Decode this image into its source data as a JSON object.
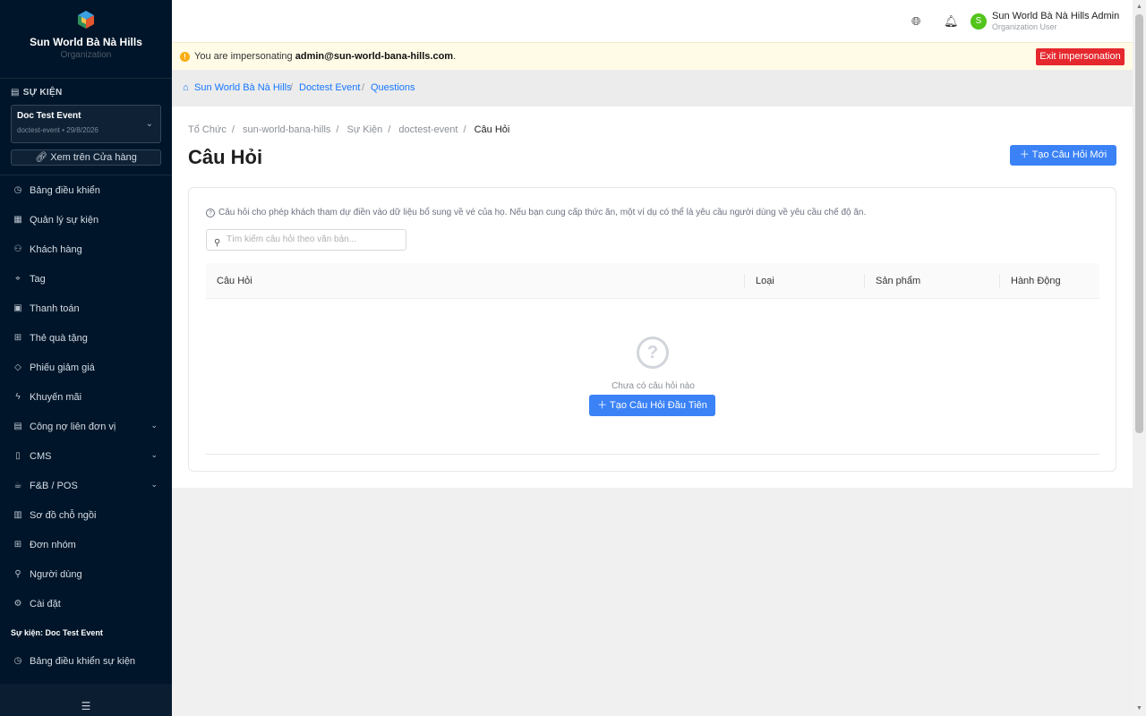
{
  "sidebar": {
    "org_name": "Sun World Bà Nà Hills",
    "org_sub": "Organization",
    "section_label": "SỰ KIỆN",
    "event_name": "Doc Test Event",
    "event_meta": "doctest-event • 29/8/2026",
    "store_button": "Xem trên Cửa hàng",
    "menu": [
      {
        "label": "Bảng điều khiển",
        "icon": "dashboard-icon"
      },
      {
        "label": "Quản lý sự kiện",
        "icon": "calendar-icon"
      },
      {
        "label": "Khách hàng",
        "icon": "users-icon"
      },
      {
        "label": "Tag",
        "icon": "tag-icon"
      },
      {
        "label": "Thanh toán",
        "icon": "payment-icon"
      },
      {
        "label": "Thẻ quà tặng",
        "icon": "gift-icon"
      },
      {
        "label": "Phiếu giảm giá",
        "icon": "coupon-icon"
      },
      {
        "label": "Khuyến mãi",
        "icon": "bolt-icon"
      },
      {
        "label": "Công nợ liên đơn vị",
        "icon": "ledger-icon"
      },
      {
        "label": "CMS",
        "icon": "cms-icon"
      },
      {
        "label": "F&B / POS",
        "icon": "coffee-icon"
      },
      {
        "label": "Sơ đồ chỗ ngồi",
        "icon": "seat-map-icon"
      },
      {
        "label": "Đơn nhóm",
        "icon": "grid-icon"
      },
      {
        "label": "Người dùng",
        "icon": "user-icon"
      },
      {
        "label": "Cài đặt",
        "icon": "gear-icon"
      }
    ],
    "event_group_label": "Sự kiện: Doc Test Event",
    "event_menu": [
      {
        "label": "Bảng điều khiển sự kiện",
        "icon": "dashboard-icon"
      }
    ]
  },
  "header": {
    "user_initial": "S",
    "user_name": "Sun World Bà Nà Hills Admin",
    "user_role": "Organization User"
  },
  "impersonation": {
    "prefix": "You are impersonating ",
    "email": "admin@sun-world-bana-hills.com",
    "suffix": ".",
    "exit_label": "Exit impersonation"
  },
  "top_breadcrumb": [
    "Sun World Bà Nà Hills",
    "Doctest Event",
    "Questions"
  ],
  "breadcrumb": [
    "Tổ Chức",
    "sun-world-bana-hills",
    "Sự Kiện",
    "doctest-event",
    "Câu Hỏi"
  ],
  "page": {
    "title": "Câu Hỏi",
    "new_button": "Tạo Câu Hỏi Mới",
    "hint": "Câu hỏi cho phép khách tham dự điền vào dữ liệu bổ sung về vé của họ. Nếu bạn cung cấp thức ăn, một ví dụ có thể là yêu cầu người dùng về yêu cầu chế độ ăn.",
    "search_placeholder": "Tìm kiếm câu hỏi theo văn bản...",
    "columns": [
      "Câu Hỏi",
      "Loại",
      "Sản phẩm",
      "Hành Động"
    ],
    "empty_text": "Chưa có câu hỏi nào",
    "first_button": "Tạo Câu Hỏi Đầu Tiên"
  },
  "colors": {
    "sidebar_bg": "#001529",
    "primary": "#3b82f6",
    "danger": "#e5282e",
    "warning_bg": "#fffbe6",
    "avatar": "#52c41a"
  }
}
